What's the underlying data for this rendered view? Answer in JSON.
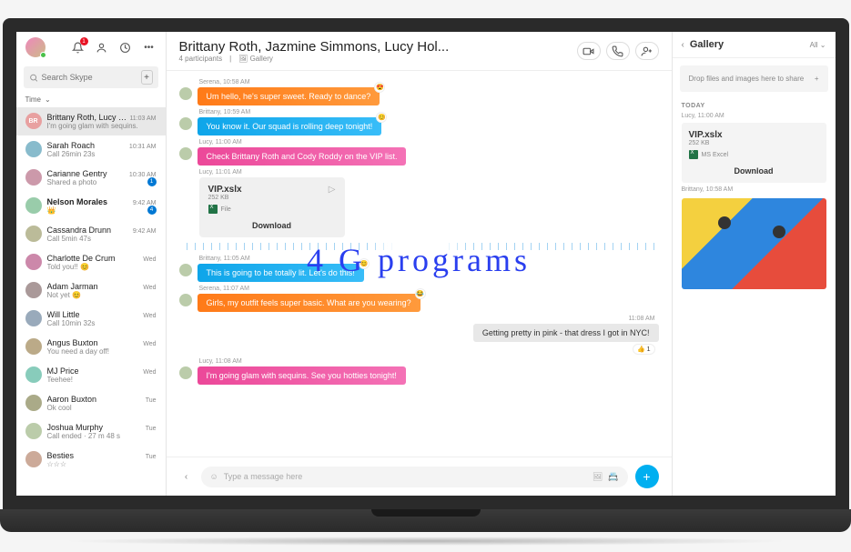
{
  "overlay": "4 G  programs",
  "sidebar": {
    "search_placeholder": "Search Skype",
    "bell_badge": "1",
    "time_filter": "Time",
    "chats": [
      {
        "name": "Brittany Roth, Lucy Hol...",
        "sub": "I'm going glam with sequins.",
        "time": "11:03 AM",
        "initials": "BR",
        "color": "#e8a0a0",
        "sel": true
      },
      {
        "name": "Sarah Roach",
        "sub": "Call 26min 23s",
        "time": "10:31 AM",
        "color": "#8bc"
      },
      {
        "name": "Carianne Gentry",
        "sub": "Shared a photo",
        "time": "10:30 AM",
        "color": "#c9a",
        "badge": "1"
      },
      {
        "name": "Nelson Morales",
        "sub": "👑",
        "time": "9:42 AM",
        "color": "#9ca",
        "bold": true,
        "unread": "4"
      },
      {
        "name": "Cassandra Drunn",
        "sub": "Call 5min 47s",
        "time": "9:42 AM",
        "color": "#bb9"
      },
      {
        "name": "Charlotte De Crum",
        "sub": "Told you!! 😊",
        "time": "Wed",
        "color": "#c8a"
      },
      {
        "name": "Adam Jarman",
        "sub": "Not yet 😊",
        "time": "Wed",
        "color": "#a99"
      },
      {
        "name": "Will Little",
        "sub": "Call 10min 32s",
        "time": "Wed",
        "color": "#9ab"
      },
      {
        "name": "Angus Buxton",
        "sub": "You need a day off!",
        "time": "Wed",
        "color": "#ba8"
      },
      {
        "name": "MJ Price",
        "sub": "Teehee!",
        "time": "Wed",
        "color": "#8cb"
      },
      {
        "name": "Aaron Buxton",
        "sub": "Ok cool",
        "time": "Tue",
        "color": "#aa8"
      },
      {
        "name": "Joshua Murphy",
        "sub": "Call ended · 27 m 48 s",
        "time": "Tue",
        "color": "#bca"
      },
      {
        "name": "Besties",
        "sub": "☆☆☆",
        "time": "Tue",
        "color": "#ca9"
      }
    ]
  },
  "chat": {
    "title": "Brittany Roth, Jazmine Simmons, Lucy Hol...",
    "participants": "4 participants",
    "gallery_link": "Gallery",
    "messages": [
      {
        "meta": "Serena, 10:58 AM",
        "text": "Um hello, he's super sweet. Ready to dance?",
        "style": "orange",
        "react": "😍"
      },
      {
        "meta": "Brittany, 10:59 AM",
        "text": "You know it. Our squad is rolling deep tonight!",
        "style": "blue",
        "react": "😊"
      },
      {
        "meta": "Lucy, 11:00 AM",
        "text": "Check Brittany Roth and Cody Roddy on the VIP list.",
        "style": "pink"
      },
      {
        "meta": "Lucy, 11:01 AM",
        "file": {
          "name": "VIP.xslx",
          "size": "252 KB",
          "type": "File",
          "download": "Download"
        }
      },
      {
        "meta": "Brittany, 11:05 AM",
        "text": "This is going to be totally lit. Let's do this!",
        "style": "blue",
        "react": "😊"
      },
      {
        "meta": "Serena, 11:07 AM",
        "text": "Girls, my outfit feels super basic. What are you wearing?",
        "style": "orange",
        "react": "😂"
      },
      {
        "meta": "11:08 AM",
        "text": "Getting pretty in pink - that dress I got in NYC!",
        "style": "gray",
        "right": true,
        "reaction": "👍 1"
      },
      {
        "meta": "Lucy, 11:08 AM",
        "text": "I'm going glam with sequins. See you hotties tonight!",
        "style": "pink"
      }
    ],
    "composer_placeholder": "Type a message here"
  },
  "gallery": {
    "title": "Gallery",
    "filter": "All",
    "drop": "Drop files and images here to share",
    "section": "TODAY",
    "file_meta": "Lucy, 11:00 AM",
    "file": {
      "name": "VIP.xslx",
      "size": "252 KB",
      "type": "MS Excel",
      "download": "Download"
    },
    "img_meta": "Brittany, 10:58 AM"
  }
}
